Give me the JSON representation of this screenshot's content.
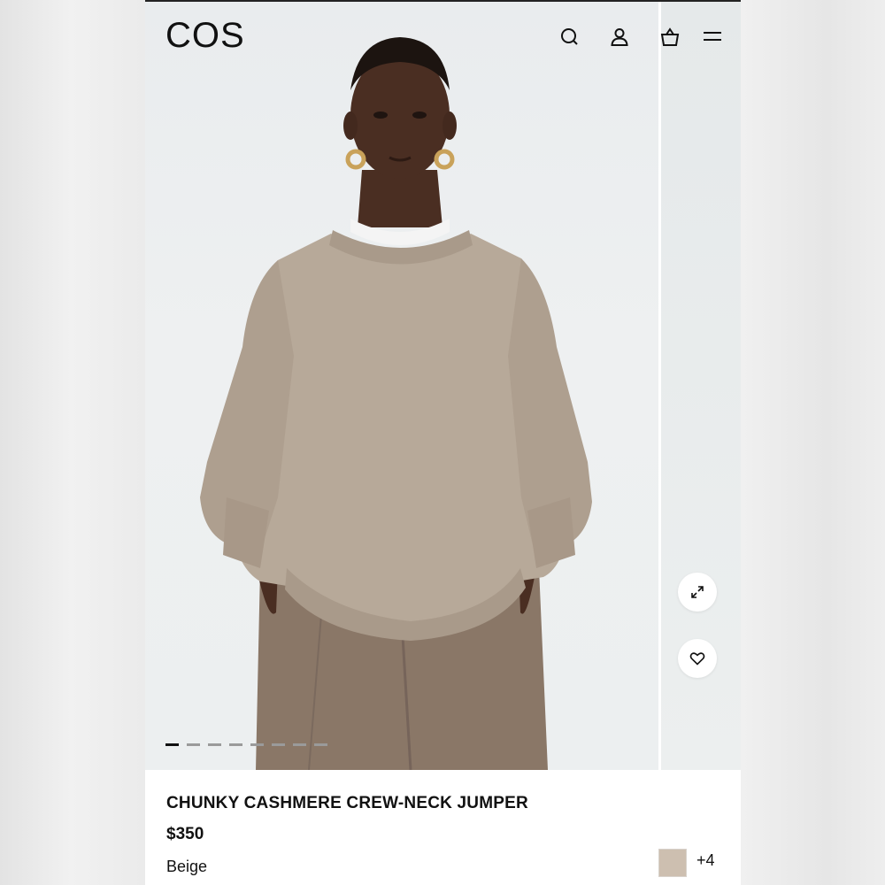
{
  "header": {
    "brand": "COS",
    "icons": [
      "search-icon",
      "account-icon",
      "bag-icon",
      "menu-icon"
    ]
  },
  "gallery": {
    "image_subject": "model wearing beige crew-neck jumper",
    "slide_count": 8,
    "active_slide": 1,
    "actions": [
      "expand-icon",
      "wishlist-heart-icon"
    ]
  },
  "product": {
    "title": "CHUNKY CASHMERE CREW-NECK JUMPER",
    "price": "$350",
    "color_name": "Beige",
    "swatch_color": "#cdbfb0",
    "more_colors": "+4"
  },
  "colors": {
    "sweater": "#b7a999",
    "trousers": "#8a7767",
    "skin": "#4a2e22",
    "hair": "#1c1410",
    "background": "#eceff0"
  }
}
